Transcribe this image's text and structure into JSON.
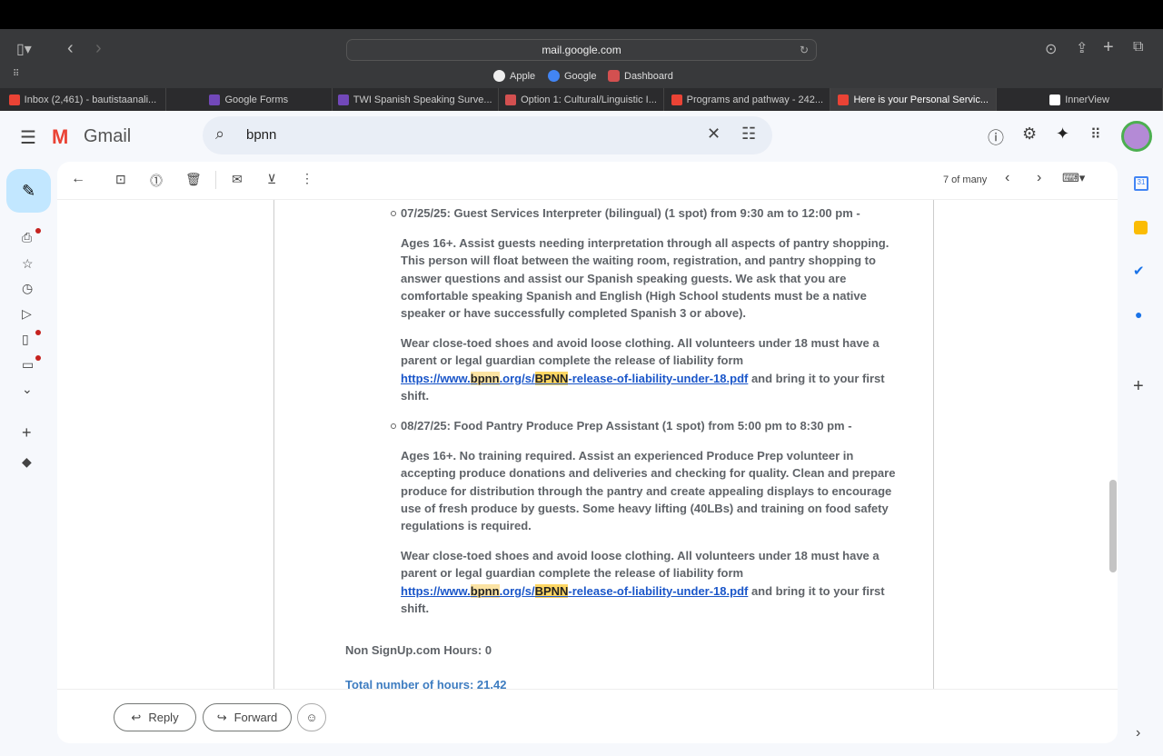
{
  "browser": {
    "url": "mail.google.com",
    "favorites": [
      "Apple",
      "Google",
      "Dashboard"
    ],
    "tabs": [
      "Inbox (2,461) - bautistaanali...",
      "Google Forms",
      "TWI Spanish Speaking Surve...",
      "Option 1: Cultural/Linguistic I...",
      "Programs and pathway - 242...",
      "Here is your Personal Servic...",
      "InnerView"
    ]
  },
  "gmail": {
    "brand": "Gmail",
    "search_value": "bpnn",
    "pager": "7 of many"
  },
  "email": {
    "items": [
      {
        "heading": "07/25/25: Guest Services Interpreter (bilingual) (1 spot) from 9:30 am to 12:00 pm -",
        "description": "Ages 16+. Assist guests needing interpretation through all aspects of pantry shopping. This person will float between the waiting room, registration, and pantry shopping to answer questions and assist our Spanish speaking guests. We ask that you are comfortable speaking Spanish and English (High School students must be a native speaker or have successfully completed Spanish 3 or above).",
        "wear": "Wear close-toed shoes and avoid loose clothing. All volunteers under 18 must have a parent or legal guardian complete the release of liability form",
        "link_a": "https://www.",
        "link_b": "bpnn",
        ".": "",
        "link_c": ".org/s/",
        "link_d": "BPNN",
        "link_e": "-release-of-liability-under-18.pdf",
        "after": " and bring it to your first shift."
      },
      {
        "heading": "08/27/25: Food Pantry Produce Prep Assistant (1 spot) from 5:00 pm to 8:30 pm -",
        "description": "Ages 16+. No training required. Assist an experienced Produce Prep volunteer in accepting produce donations and deliveries and checking for quality. Clean and prepare produce for distribution through the pantry and create appealing displays to encourage use of fresh produce by guests. Some heavy lifting (40LBs) and training on food safety regulations is required.",
        "wear": "Wear close-toed shoes and avoid loose clothing. All volunteers under 18 must have a parent or legal guardian complete the release of liability form",
        "link_a": "https://www.",
        "link_b": "bpnn",
        "link_c": ".org/s/",
        "link_d": "BPNN",
        "link_e": "-release-of-liability-under-18.pdf",
        "after": " and bring it to your first shift."
      }
    ],
    "non_signup": "Non SignUp.com Hours: 0",
    "total": "Total number of hours: 21.42",
    "reply": "Reply",
    "forward": "Forward"
  }
}
